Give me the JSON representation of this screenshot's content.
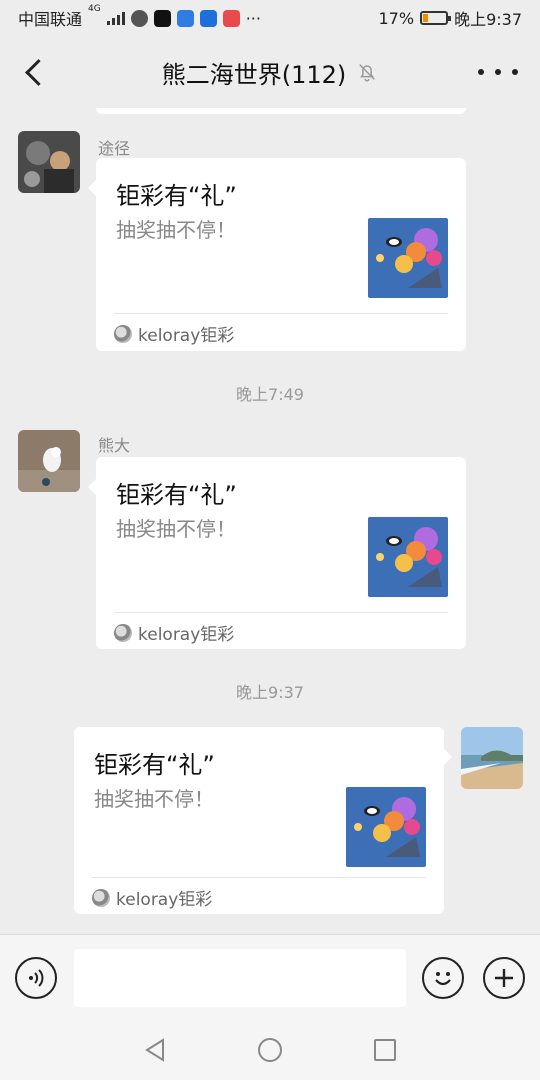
{
  "status_bar": {
    "carrier": "中国联通",
    "network": "4G",
    "battery_percent": "17%",
    "time": "晚上9:37",
    "more": "···"
  },
  "header": {
    "title": "熊二海世界(112)",
    "back_icon": "chevron-left-icon",
    "mute_icon": "bell-muted-icon",
    "more_icon": "ellipsis-icon"
  },
  "messages": [
    {
      "sender": "途径",
      "card": {
        "title": "钜彩有“礼”",
        "desc": "抽奖抽不停！",
        "source": "keloray钜彩"
      }
    },
    {
      "time": "晚上7:49",
      "sender": "熊大",
      "card": {
        "title": "钜彩有“礼”",
        "desc": "抽奖抽不停！",
        "source": "keloray钜彩"
      }
    },
    {
      "time": "晚上9:37",
      "card": {
        "title": "钜彩有“礼”",
        "desc": "抽奖抽不停！",
        "source": "keloray钜彩"
      }
    }
  ],
  "input_bar": {
    "voice_icon": "voice-icon",
    "emoji_icon": "emoji-icon",
    "plus_icon": "plus-icon"
  },
  "colors": {
    "background": "#ededed",
    "card": "#ffffff",
    "battery_low": "#f08c00"
  }
}
